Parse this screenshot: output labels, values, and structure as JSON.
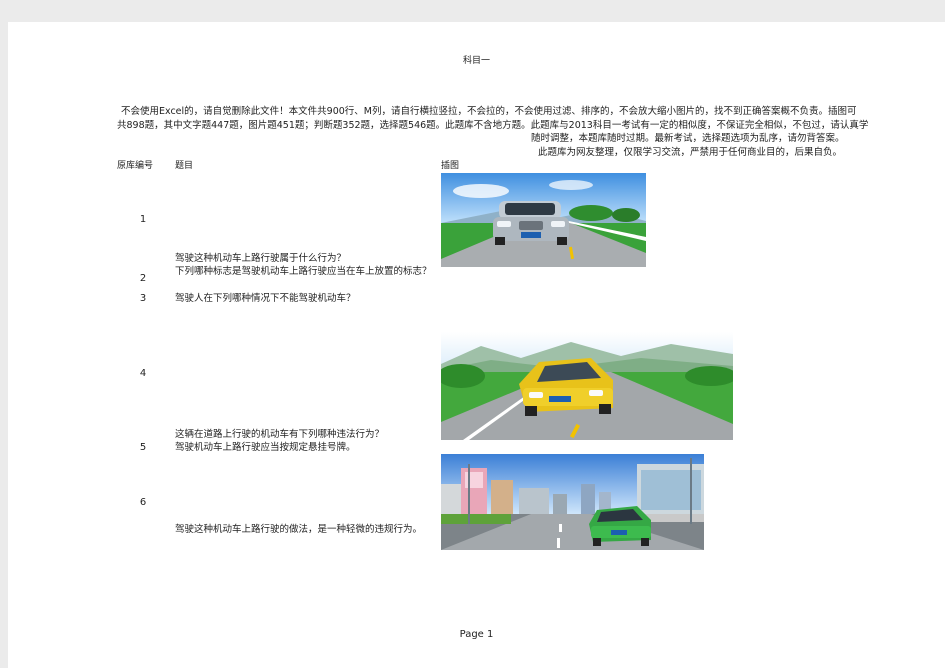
{
  "page_title": "科目一",
  "intro": {
    "line1": "不会使用Excel的，请自觉删除此文件！本文件共900行、M列，请自行横拉竖拉，不会拉的，不会使用过滤、排序的，不会放大缩小图片的，找不到正确答案概不负责。插图可",
    "line2": "共898题，其中文字题447题，图片题451题；判断题352题，选择题546题。此题库不含地方题。此题库与2013科目一考试有一定的相似度，不保证完全相似，不包过，请认真学",
    "line3": "随时调整，本题库随时过期。最新考试，选择题选项为乱序，请勿背答案。",
    "line4": "此题库为网友整理，仅限学习交流，严禁用于任何商业目的，后果自负。"
  },
  "columns": {
    "id": "原库编号",
    "question": "题目",
    "image": "插图"
  },
  "rows": [
    {
      "id": "1",
      "question": "驾驶这种机动车上路行驶属于什么行为？"
    },
    {
      "id": "2",
      "question": "下列哪种标志是驾驶机动车上路行驶应当在车上放置的标志？"
    },
    {
      "id": "3",
      "question": "驾驶人在下列哪种情况下不能驾驶机动车？"
    },
    {
      "id": "4",
      "question": "这辆在道路上行驶的机动车有下列哪种违法行为？"
    },
    {
      "id": "5",
      "question": "驾驶机动车上路行驶应当按规定悬挂号牌。"
    },
    {
      "id": "6",
      "question": "驾驶这种机动车上路行驶的做法，是一种轻微的违规行为。"
    }
  ],
  "images": {
    "img1": "silver-car-on-road-illustration",
    "img4": "yellow-car-on-road-illustration",
    "img6": "green-car-city-street-illustration"
  },
  "colors": {
    "sky": "#6aaef0",
    "grass": "#3aa23a",
    "road": "#a9adb0",
    "lane": "#f2c200",
    "car_silver": "#aeb7bf",
    "car_yellow": "#e8c21a",
    "car_green": "#35a845"
  },
  "footer": "Page  1"
}
